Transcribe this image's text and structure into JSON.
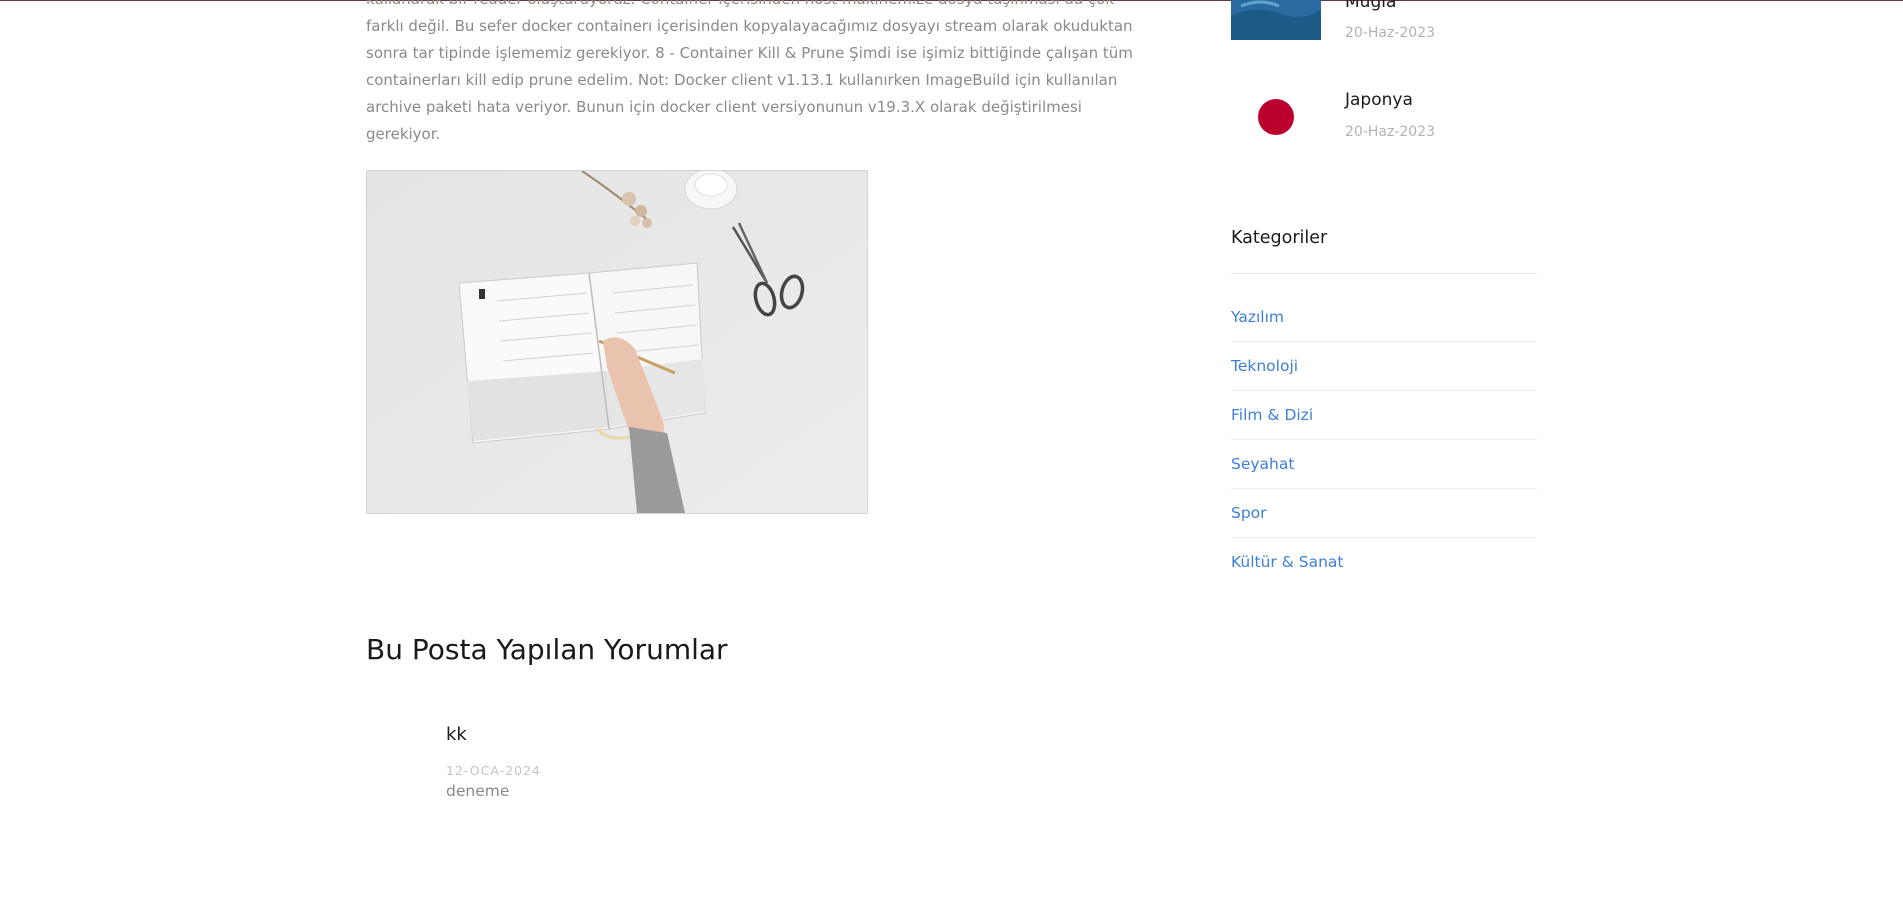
{
  "article": {
    "text": "kullanarak bir reader oluşturuyoruz. Container içerisinden host makinemize dosya taşınması da çok farklı değil. Bu sefer docker containerı içerisinden kopyalayacağımız dosyayı stream olarak okuduktan sonra tar tipinde işlememiz gerekiyor. 8 - Container Kill & Prune Şimdi ise işimiz bittiğinde çalışan tüm containerları kill edip prune edelim. Not: Docker client v1.13.1 kullanırken ImageBuild için kullanılan archive paketi hata veriyor. Bunun için docker client versiyonunun v19.3.X olarak değiştirilmesi gerekiyor."
  },
  "comments": {
    "title": "Bu Posta Yapılan Yorumlar",
    "items": [
      {
        "author": "kk",
        "date": "12-OCA-2024",
        "body": "deneme"
      }
    ]
  },
  "sidebar": {
    "recent_posts": [
      {
        "title": "Muğla",
        "date": "20-Haz-2023",
        "thumb_icon": "coast-aerial-image"
      },
      {
        "title": "Japonya",
        "date": "20-Haz-2023",
        "thumb_icon": "japan-flag-image"
      }
    ],
    "categories": {
      "heading": "Kategoriler",
      "items": [
        "Yazılım",
        "Teknoloji",
        "Film & Dizi",
        "Seyahat",
        "Spor",
        "Kültür & Sanat"
      ]
    }
  },
  "colors": {
    "link": "#3e7fd7",
    "body_text": "#8a8a8a",
    "japan_red": "#bc002d"
  }
}
